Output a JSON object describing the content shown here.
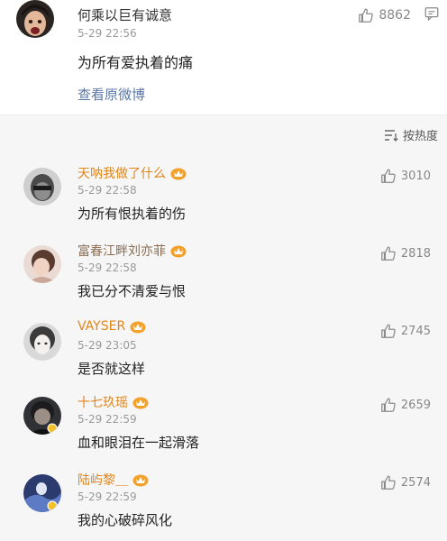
{
  "top_comment": {
    "username": "何乘以巨有诚意",
    "time": "5-29 22:56",
    "text": "为所有爱执着的痛",
    "likes": "8862",
    "view_original": "查看原微博"
  },
  "sort": {
    "label": "按热度"
  },
  "replies": [
    {
      "username": "天呐我做了什么",
      "time": "5-29 22:58",
      "text": "为所有恨执着的伤",
      "likes": "3010"
    },
    {
      "username": "富春江畔刘亦菲",
      "time": "5-29 22:58",
      "text": "我已分不清爱与恨",
      "likes": "2818"
    },
    {
      "username": "VAYSER",
      "time": "5-29 23:05",
      "text": "是否就这样",
      "likes": "2745"
    },
    {
      "username": "十七玖瑶",
      "time": "5-29 22:59",
      "text": "血和眼泪在一起滑落",
      "likes": "2659"
    },
    {
      "username": "陆屿黎＿",
      "time": "5-29 22:59",
      "text": "我的心破碎风化",
      "likes": "2574"
    }
  ],
  "colors": {
    "username": "#e0861b",
    "link": "#5b79a8",
    "meta": "#9a9a9a"
  },
  "icons": [
    "thumbs-up-icon",
    "reply-icon",
    "sort-icon",
    "vip-crown-icon"
  ]
}
